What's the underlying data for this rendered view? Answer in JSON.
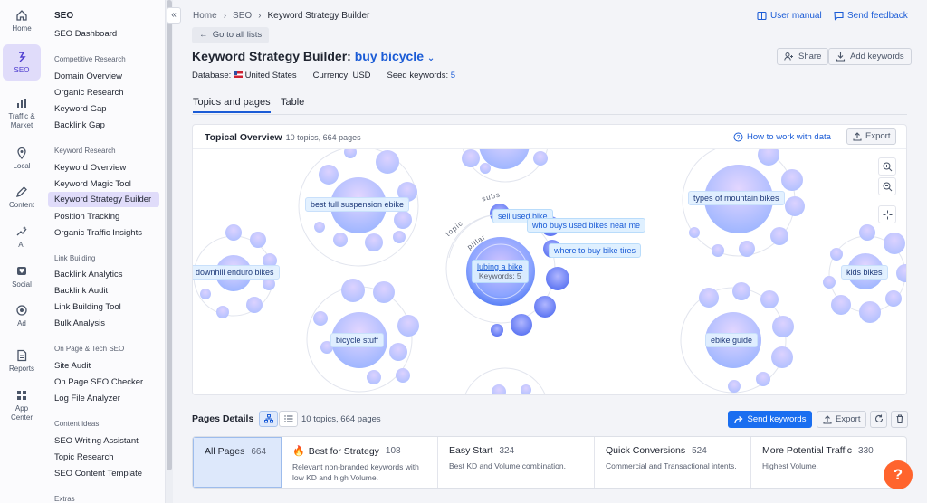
{
  "rail": [
    {
      "label": "Home",
      "icon": "home-icon"
    },
    {
      "label": "SEO",
      "icon": "seo-icon",
      "active": true
    },
    {
      "label": "Traffic &\nMarket",
      "icon": "chart-icon"
    },
    {
      "label": "Local",
      "icon": "pin-icon"
    },
    {
      "label": "Content",
      "icon": "pen-icon"
    },
    {
      "label": "AI",
      "icon": "sparkle-icon"
    },
    {
      "label": "Social",
      "icon": "heart-icon"
    },
    {
      "label": "Ad",
      "icon": "ad-icon"
    },
    {
      "label": "Reports",
      "icon": "report-icon"
    },
    {
      "label": "App\nCenter",
      "icon": "apps-icon"
    }
  ],
  "sidebar": {
    "title": "SEO",
    "dashboard": "SEO Dashboard",
    "sections": [
      {
        "label": "Competitive Research",
        "items": [
          "Domain Overview",
          "Organic Research",
          "Keyword Gap",
          "Backlink Gap"
        ]
      },
      {
        "label": "Keyword Research",
        "items": [
          "Keyword Overview",
          "Keyword Magic Tool",
          "Keyword Strategy Builder",
          "Position Tracking",
          "Organic Traffic Insights"
        ]
      },
      {
        "label": "Link Building",
        "items": [
          "Backlink Analytics",
          "Backlink Audit",
          "Link Building Tool",
          "Bulk Analysis"
        ]
      },
      {
        "label": "On Page & Tech SEO",
        "items": [
          "Site Audit",
          "On Page SEO Checker",
          "Log File Analyzer"
        ]
      },
      {
        "label": "Content ideas",
        "items": [
          "SEO Writing Assistant",
          "Topic Research",
          "SEO Content Template"
        ]
      },
      {
        "label": "Extras",
        "items": []
      }
    ],
    "collapse": "«"
  },
  "breadcrumb": [
    "Home",
    "SEO",
    "Keyword Strategy Builder"
  ],
  "top_links": {
    "manual": "User manual",
    "feedback": "Send feedback"
  },
  "back_button": "Go to all lists",
  "title": {
    "prefix": "Keyword Strategy Builder:",
    "keyword": "buy bicycle"
  },
  "meta": {
    "database_label": "Database:",
    "database_value": "United States",
    "currency": "Currency: USD",
    "seed_label": "Seed keywords:",
    "seed_value": "5"
  },
  "header_buttons": {
    "share": "Share",
    "add": "Add keywords"
  },
  "tabs": [
    "Topics and pages",
    "Table"
  ],
  "overview": {
    "title": "Topical Overview",
    "subtitle": "10 topics, 664 pages",
    "howto": "How to work with data",
    "export": "Export",
    "topics": {
      "full_suspension": "best full suspension ebike",
      "downhill": "downhill enduro bikes",
      "bicycle_stuff": "bicycle stuff",
      "mountain": "types of mountain bikes",
      "kids": "kids bikes",
      "ebike": "ebike guide"
    },
    "pillar": {
      "name": "lubing a bike",
      "keywords": "Keywords: 5"
    },
    "subs": [
      "sell used bike",
      "who buys used bikes near me",
      "where to buy bike tires"
    ],
    "arc_words": {
      "subs": "subs",
      "topic": "topic",
      "pillar": "pillar"
    }
  },
  "pages_details": {
    "title": "Pages Details",
    "subtitle": "10 topics, 664 pages",
    "send": "Send keywords",
    "export": "Export",
    "cards": [
      {
        "title": "All Pages",
        "count": "664",
        "desc": ""
      },
      {
        "title": "Best for Strategy",
        "count": "108",
        "desc": "Relevant non-branded keywords with low KD and high Volume."
      },
      {
        "title": "Easy Start",
        "count": "324",
        "desc": "Best KD and Volume combination."
      },
      {
        "title": "Quick Conversions",
        "count": "524",
        "desc": "Commercial and Transactional intents."
      },
      {
        "title": "More Potential Traffic",
        "count": "330",
        "desc": "Highest Volume."
      }
    ]
  },
  "help": "?",
  "colors": {
    "accent": "#1a5bd6",
    "primary_button": "#1a6ef0",
    "help": "#ff642d",
    "active_nav": "#e0dcfa"
  }
}
